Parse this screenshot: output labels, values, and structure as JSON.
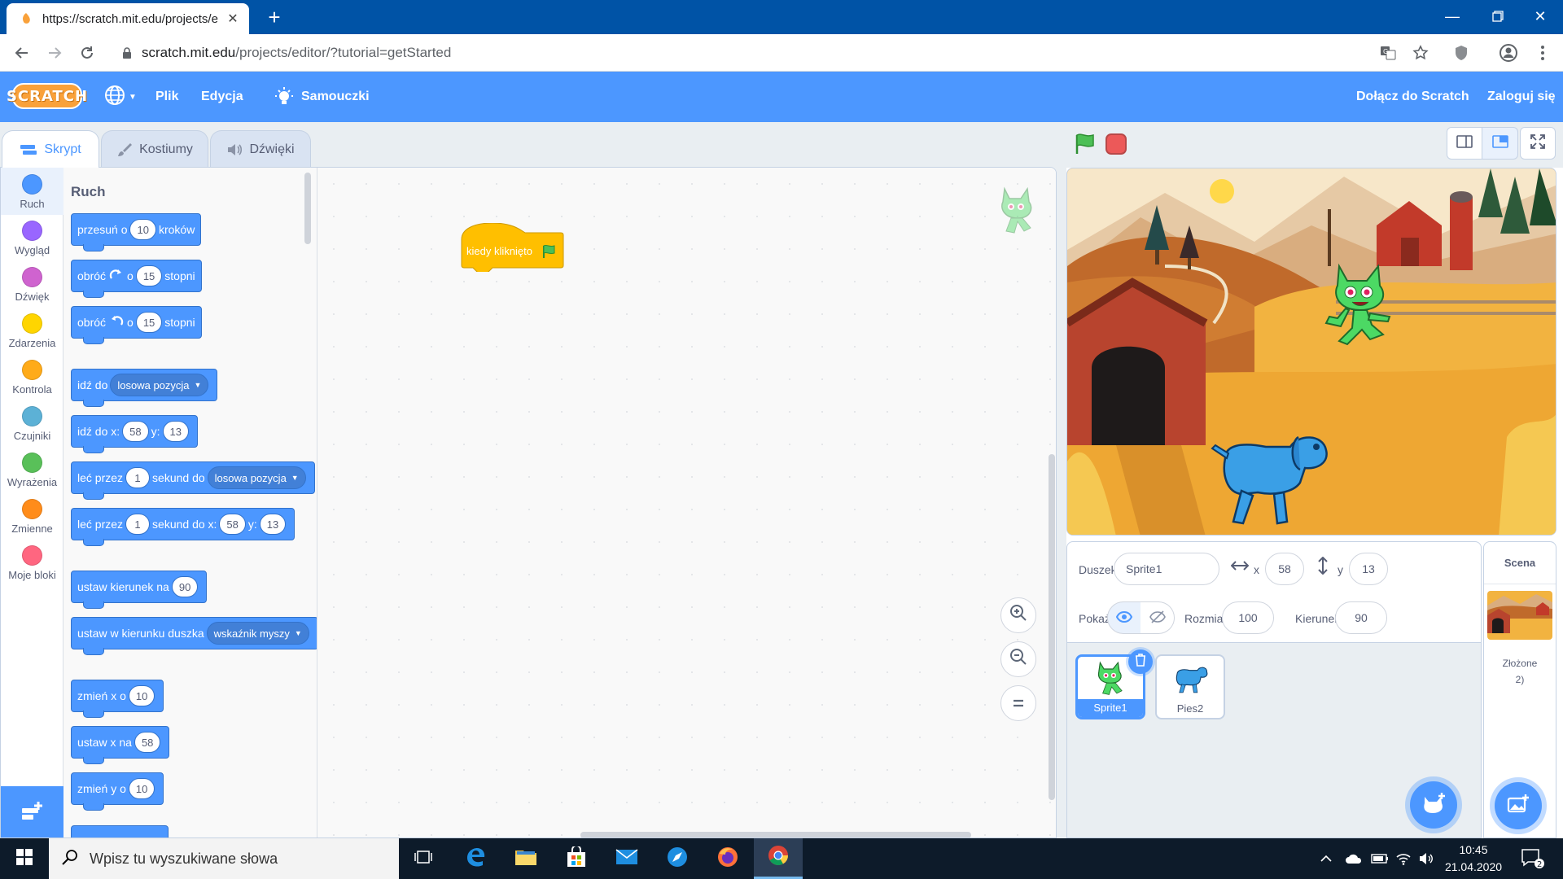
{
  "browser": {
    "tab_title": "https://scratch.mit.edu/projects/e",
    "new_tab": "+",
    "url_host": "scratch.mit.edu",
    "url_path": "/projects/editor/?tutorial=getStarted"
  },
  "menu": {
    "logo": "SCRATCH",
    "file": "Plik",
    "edit": "Edycja",
    "tutorials": "Samouczki",
    "join": "Dołącz do Scratch",
    "login": "Zaloguj się"
  },
  "tabs": {
    "code": "Skrypt",
    "costumes": "Kostiumy",
    "sounds": "Dźwięki"
  },
  "categories": [
    {
      "label": "Ruch",
      "color": "#4c97ff"
    },
    {
      "label": "Wygląd",
      "color": "#9966ff"
    },
    {
      "label": "Dźwięk",
      "color": "#cf63cf"
    },
    {
      "label": "Zdarzenia",
      "color": "#ffd500"
    },
    {
      "label": "Kontrola",
      "color": "#ffab19"
    },
    {
      "label": "Czujniki",
      "color": "#5cb1d6"
    },
    {
      "label": "Wyrażenia",
      "color": "#59c059"
    },
    {
      "label": "Zmienne",
      "color": "#ff8c1a"
    },
    {
      "label": "Moje bloki",
      "color": "#ff6680"
    }
  ],
  "palette": {
    "title": "Ruch",
    "move": {
      "a": "przesuń o",
      "v": "10",
      "b": "kroków"
    },
    "turn_right": {
      "a": "obróć",
      "o": "o",
      "v": "15",
      "b": "stopni"
    },
    "turn_left": {
      "a": "obróć",
      "o": "o",
      "v": "15",
      "b": "stopni"
    },
    "goto": {
      "a": "idź do",
      "dd": "losowa pozycja"
    },
    "goto_xy": {
      "a": "idź do x:",
      "x": "58",
      "y_lbl": "y:",
      "y": "13"
    },
    "glide": {
      "a": "leć przez",
      "v": "1",
      "b": "sekund do",
      "dd": "losowa pozycja"
    },
    "glide_xy": {
      "a": "leć przez",
      "v": "1",
      "b": "sekund do x:",
      "x": "58",
      "y_lbl": "y:",
      "y": "13"
    },
    "point_dir": {
      "a": "ustaw kierunek na",
      "v": "90"
    },
    "point_towards": {
      "a": "ustaw w kierunku duszka",
      "dd": "wskaźnik myszy"
    },
    "change_x": {
      "a": "zmień x o",
      "v": "10"
    },
    "set_x": {
      "a": "ustaw x na",
      "v": "58"
    },
    "change_y": {
      "a": "zmień y o",
      "v": "10"
    }
  },
  "script": {
    "hat_label": "kiedy kliknięto"
  },
  "sprite_info": {
    "sprite_label": "Duszek",
    "sprite_name": "Sprite1",
    "x_label": "x",
    "x": "58",
    "y_label": "y",
    "y": "13",
    "show_label": "Pokaż",
    "size_label": "Rozmiar",
    "size": "100",
    "direction_label": "Kierunek",
    "direction": "90"
  },
  "sprites": [
    {
      "name": "Sprite1",
      "selected": true
    },
    {
      "name": "Pies2",
      "selected": false
    }
  ],
  "scene": {
    "title": "Scena",
    "sub1": "Złożone",
    "sub2": "2)"
  },
  "taskbar": {
    "search_placeholder": "Wpisz tu wyszukiwane słowa",
    "time": "10:45",
    "date": "21.04.2020",
    "notifications": "2"
  }
}
